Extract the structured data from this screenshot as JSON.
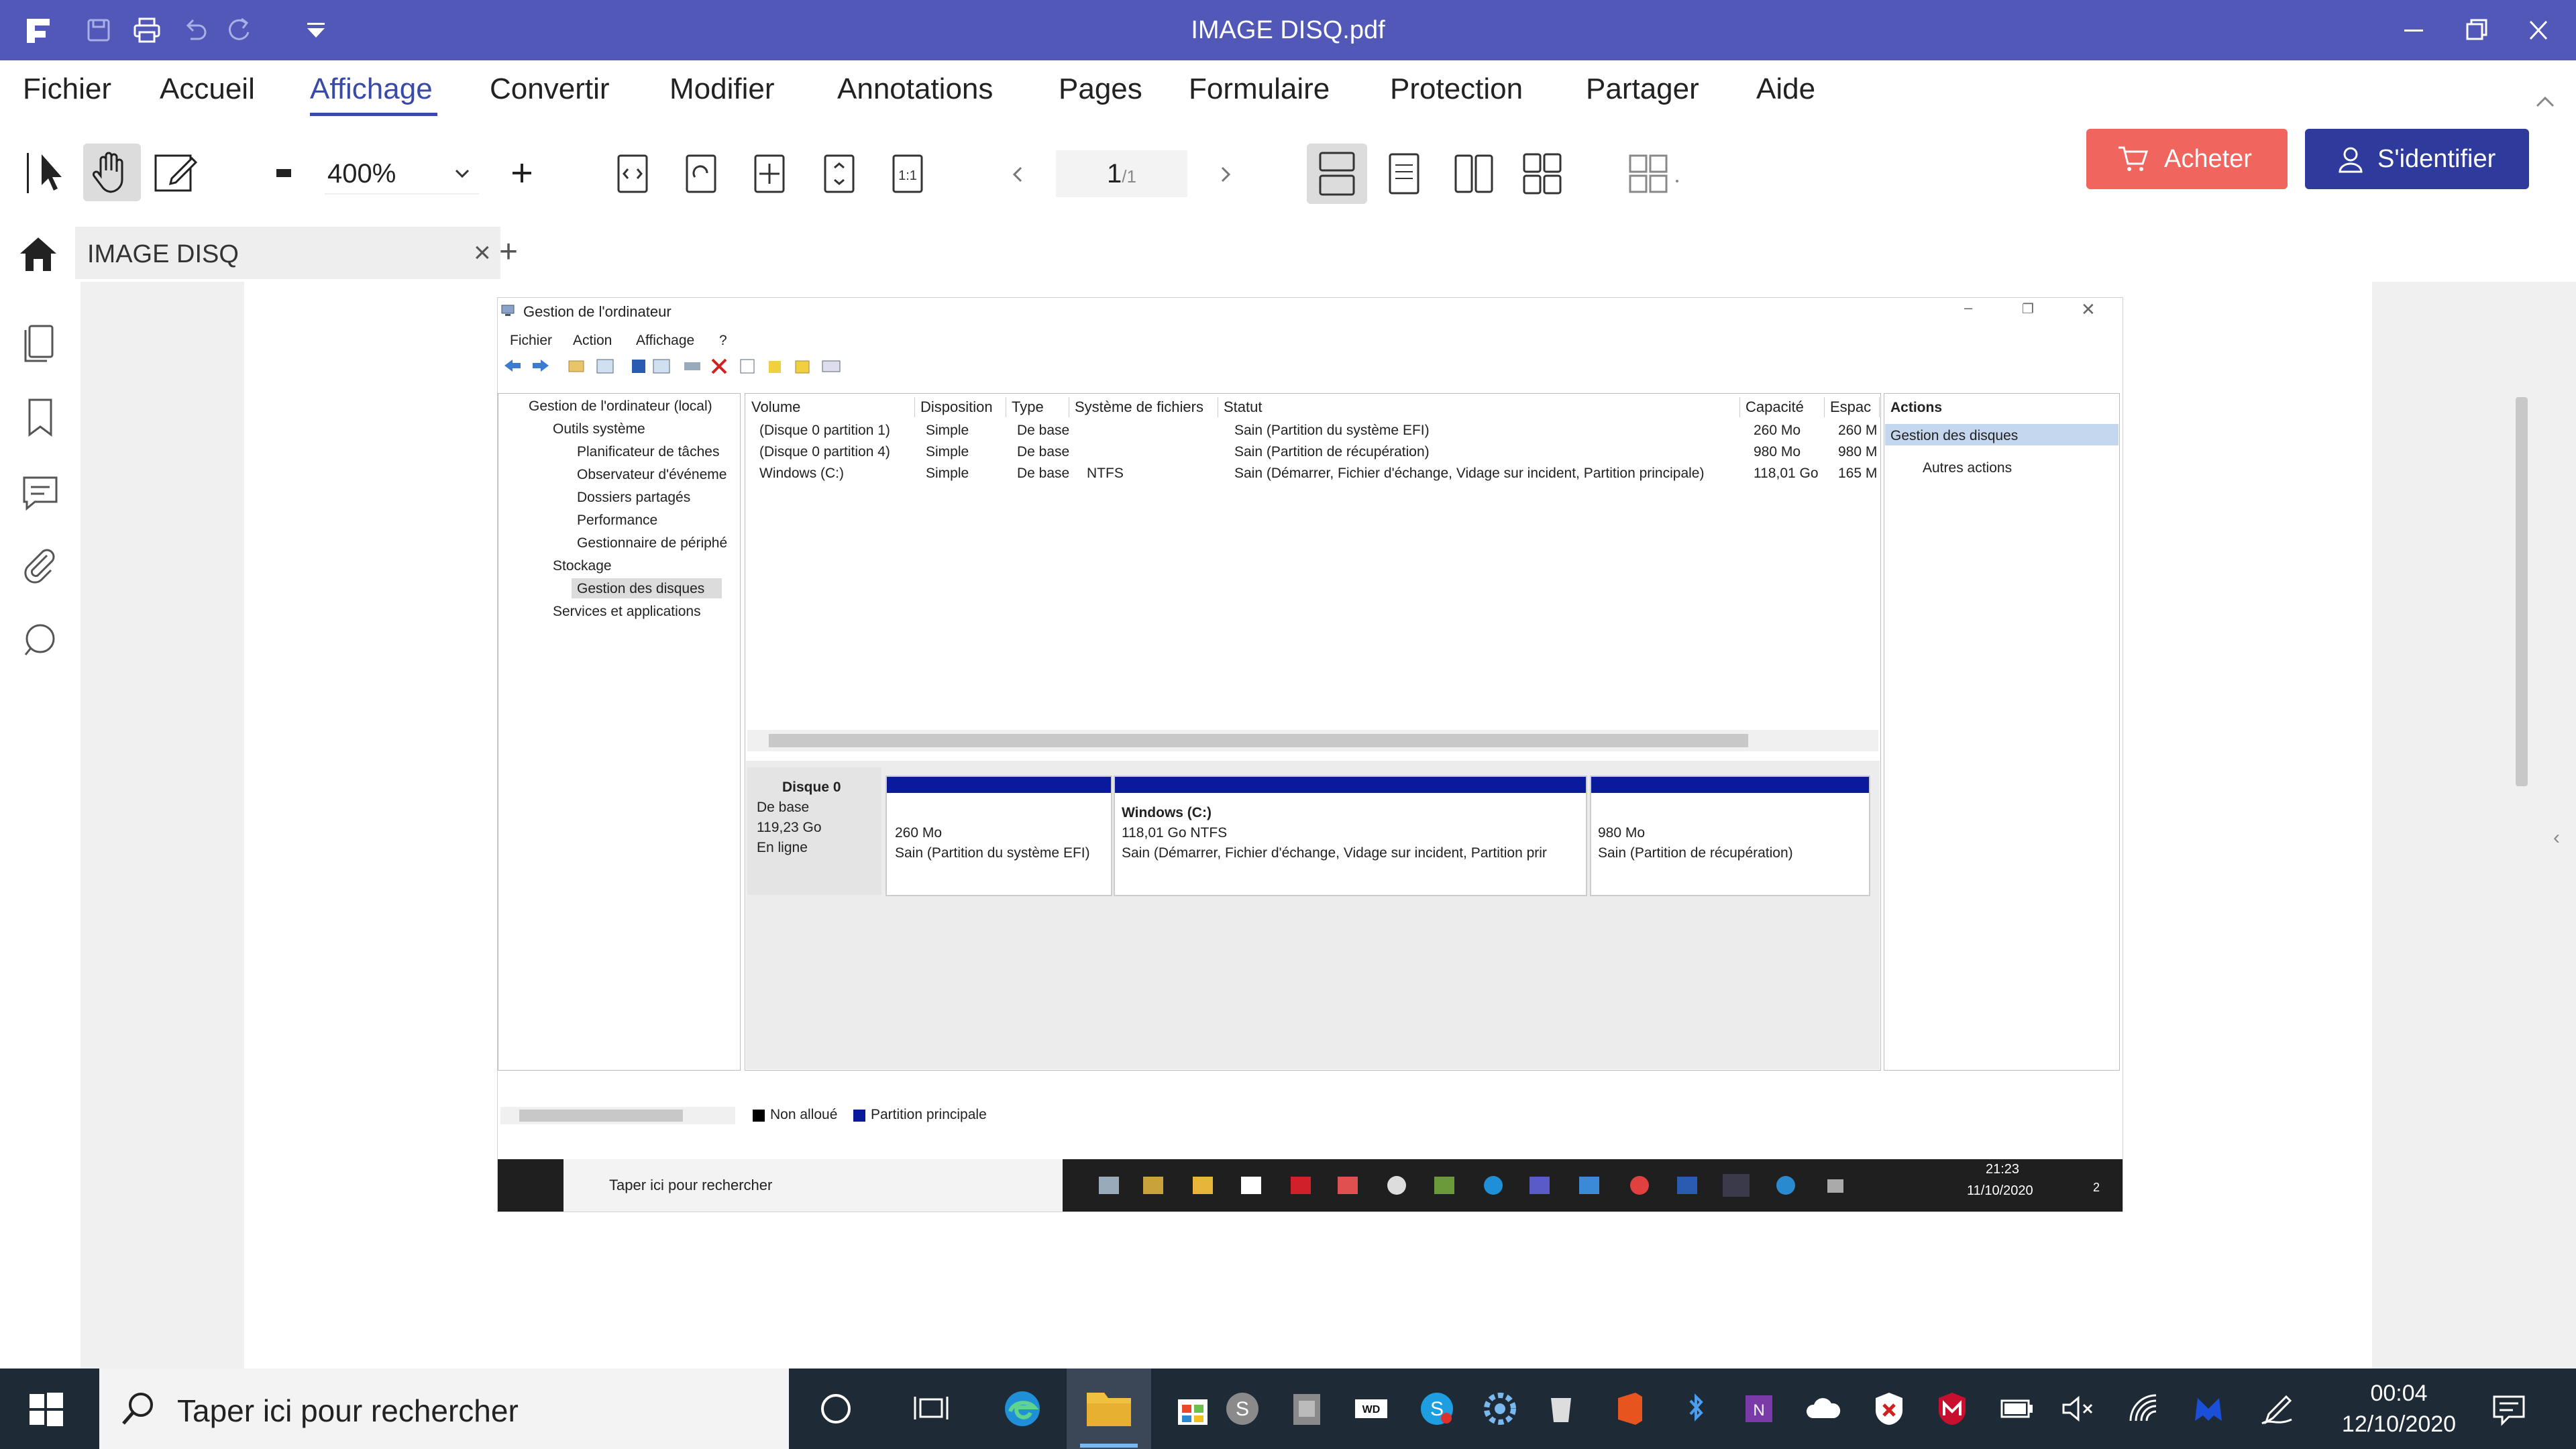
{
  "app": {
    "title": "IMAGE DISQ.pdf"
  },
  "menu": {
    "items": [
      "Fichier",
      "Accueil",
      "Affichage",
      "Convertir",
      "Modifier",
      "Annotations",
      "Pages",
      "Formulaire",
      "Protection",
      "Partager",
      "Aide"
    ],
    "active": "Affichage"
  },
  "toolbar": {
    "zoom": "400%",
    "page_current": "1",
    "page_total": "/1",
    "buy_label": "Acheter",
    "signin_label": "S'identifier"
  },
  "tab": {
    "label": "IMAGE DISQ",
    "close": "×",
    "add": "+"
  },
  "sidepanel": {
    "toggle": "›",
    "right_toggle": "‹"
  },
  "embedded": {
    "window_title": "Gestion de l'ordinateur",
    "menu": [
      "Fichier",
      "Action",
      "Affichage",
      "?"
    ],
    "tree": [
      "Gestion de l'ordinateur (local)",
      "Outils système",
      "Planificateur de tâches",
      "Observateur d'événeme",
      "Dossiers partagés",
      "Performance",
      "Gestionnaire de périphé",
      "Stockage",
      "Gestion des disques",
      "Services et applications"
    ],
    "columns": [
      "Volume",
      "Disposition",
      "Type",
      "Système de fichiers",
      "Statut",
      "Capacité",
      "Espac"
    ],
    "rows": [
      [
        "(Disque 0 partition 1)",
        "Simple",
        "De base",
        "",
        "Sain (Partition du système EFI)",
        "260 Mo",
        "260 M"
      ],
      [
        "(Disque 0 partition 4)",
        "Simple",
        "De base",
        "",
        "Sain (Partition de récupération)",
        "980 Mo",
        "980 M"
      ],
      [
        "Windows (C:)",
        "Simple",
        "De base",
        "NTFS",
        "Sain (Démarrer, Fichier d'échange, Vidage sur incident, Partition principale)",
        "118,01 Go",
        "165 M"
      ]
    ],
    "actions": {
      "header": "Actions",
      "selected": "Gestion des disques",
      "other": "Autres actions"
    },
    "disk": {
      "name": "Disque 0",
      "type": "De base",
      "size": "119,23 Go",
      "state": "En ligne",
      "partitions": [
        {
          "title": "",
          "size": "260 Mo",
          "status": "Sain (Partition du système EFI)"
        },
        {
          "title": "Windows  (C:)",
          "size": "118,01 Go NTFS",
          "status": "Sain (Démarrer, Fichier d'échange, Vidage sur incident, Partition prir"
        },
        {
          "title": "",
          "size": "980 Mo",
          "status": "Sain (Partition de récupération)"
        }
      ]
    },
    "legend": [
      "Non alloué",
      "Partition principale"
    ],
    "taskbar": {
      "search": "Taper ici pour rechercher",
      "time": "21:23",
      "date": "11/10/2020",
      "notif": "2"
    }
  },
  "taskbar": {
    "search_placeholder": "Taper ici pour rechercher",
    "time": "00:04",
    "date": "12/10/2020"
  },
  "colors": {
    "titlebar": "#5158b8",
    "accent": "#3a4aa8",
    "buy": "#f0665e",
    "signin": "#2e3a9c",
    "partition": "#0a1a9c",
    "taskbar": "#1e2a36"
  }
}
